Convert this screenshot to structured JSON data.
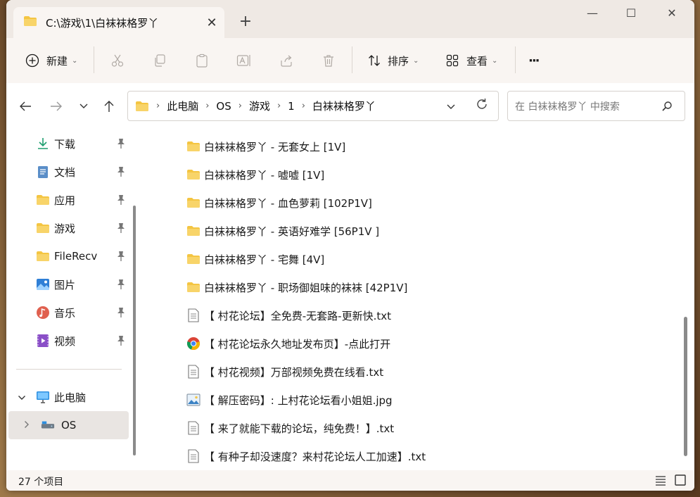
{
  "window": {
    "tab_title": "C:\\游戏\\1\\白袜袜格罗丫",
    "accent": "#0067c0",
    "folder_color": "#f4c542"
  },
  "toolbar": {
    "new_label": "新建",
    "sort_label": "排序",
    "view_label": "查看",
    "more_label": "···"
  },
  "address": {
    "crumbs": [
      "此电脑",
      "OS",
      "游戏",
      "1",
      "白袜袜格罗丫"
    ]
  },
  "search": {
    "placeholder": "在 白袜袜格罗丫 中搜索"
  },
  "sidebar": {
    "items": [
      {
        "label": "下载",
        "icon": "download-icon"
      },
      {
        "label": "文档",
        "icon": "document-icon"
      },
      {
        "label": "应用",
        "icon": "folder-icon"
      },
      {
        "label": "游戏",
        "icon": "folder-icon"
      },
      {
        "label": "FileRecv",
        "icon": "folder-icon"
      },
      {
        "label": "图片",
        "icon": "pictures-icon"
      },
      {
        "label": "音乐",
        "icon": "music-icon"
      },
      {
        "label": "视频",
        "icon": "video-icon"
      }
    ],
    "this_pc": "此电脑",
    "os_drive": "OS"
  },
  "files": [
    {
      "name": "白袜袜格罗丫 - 无套女上 [1V]",
      "type": "folder"
    },
    {
      "name": "白袜袜格罗丫 - 嘘嘘 [1V]",
      "type": "folder"
    },
    {
      "name": "白袜袜格罗丫 - 血色萝莉 [102P1V]",
      "type": "folder"
    },
    {
      "name": "白袜袜格罗丫 - 英语好难学 [56P1V ]",
      "type": "folder"
    },
    {
      "name": "白袜袜格罗丫 - 宅舞 [4V]",
      "type": "folder"
    },
    {
      "name": "白袜袜格罗丫 - 职场御姐味的袜袜 [42P1V]",
      "type": "folder"
    },
    {
      "name": "【 村花论坛】全免费-无套路-更新快.txt",
      "type": "text"
    },
    {
      "name": "【 村花论坛永久地址发布页】-点此打开",
      "type": "chrome"
    },
    {
      "name": "【 村花视频】万部视频免费在线看.txt",
      "type": "text"
    },
    {
      "name": "【 解压密码】:  上村花论坛看小姐姐.jpg",
      "type": "image"
    },
    {
      "name": "【 来了就能下载的论坛，纯免费！】.txt",
      "type": "text"
    },
    {
      "name": "【 有种子却没速度？来村花论坛人工加速】.txt",
      "type": "text"
    }
  ],
  "status": {
    "count": "27 个项目"
  }
}
